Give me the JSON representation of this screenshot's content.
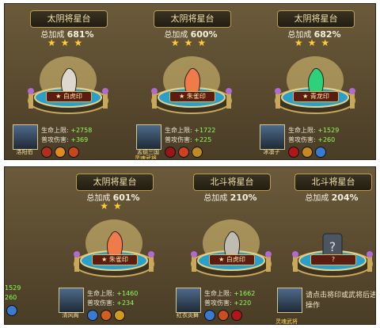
{
  "colors": {
    "panel_bg": "#5a4a30",
    "gold": "#d8b45a",
    "green_value": "#8cff5a"
  },
  "top_row": [
    {
      "title": "太阴将星台",
      "bonus_label": "总加成",
      "bonus": "681%",
      "stars": "★★★",
      "seal_text": "★ 白虎印",
      "seal_color": "#dcd8d0",
      "hp_label": "生命上限:",
      "hp": "+2758",
      "dmg_label": "普攻伤害:",
      "dmg": "+369",
      "hero": "洛阳伯",
      "badge": "",
      "skills": [
        "#b03020",
        "#e08a20",
        "#c6471a"
      ]
    },
    {
      "title": "太阴将星台",
      "bonus_label": "总加成",
      "bonus": "600%",
      "stars": "★★★",
      "seal_text": "★ 朱雀印",
      "seal_color": "#ef7a4a",
      "hp_label": "生命上限:",
      "hp": "+1722",
      "dmg_label": "普攻伤害:",
      "dmg": "+225",
      "hero": "孟德三国",
      "badge": "灵魂武将",
      "skills": [
        "#9a1515",
        "#d04020",
        "#c08a20"
      ]
    },
    {
      "title": "太阴将星台",
      "bonus_label": "总加成",
      "bonus": "682%",
      "stars": "★★★",
      "seal_text": "★ 青龙印",
      "seal_color": "#2fd07a",
      "hp_label": "生命上限:",
      "hp": "+1529",
      "dmg_label": "普攻伤害:",
      "dmg": "+260",
      "hero": "冰凛子",
      "badge": "",
      "skills": [
        "#b01818",
        "#c88a20",
        "#3a7ad0"
      ]
    }
  ],
  "bottom_row": {
    "partial": {
      "hp": "1529",
      "dmg": "260"
    },
    "cards": [
      {
        "title": "太阴将星台",
        "bonus_label": "总加成",
        "bonus": "601%",
        "stars": "★★",
        "seal_text": "★ 朱雀印",
        "seal_color": "#ef7a4a",
        "hp_label": "生命上限:",
        "hp": "+1460",
        "dmg_label": "普攻伤害:",
        "dmg": "+234",
        "hero": "清风阁",
        "badge": "",
        "skills": [
          "#3a7ad0",
          "#d06020",
          "#d09a20"
        ]
      },
      {
        "title": "北斗将星台",
        "bonus_label": "总加成",
        "bonus": "210%",
        "stars": "",
        "seal_text": "★ 白虎印",
        "seal_color": "#bfbcb2",
        "hp_label": "生命上限:",
        "hp": "+1662",
        "dmg_label": "普攻伤害:",
        "dmg": "+220",
        "hero": "红衣炎舞",
        "badge": "",
        "skills": [
          "#3a7ad0",
          "#c85020",
          "#b01818"
        ]
      },
      {
        "title": "北斗将星台",
        "bonus_label": "总加成",
        "bonus": "204%",
        "stars": "",
        "seal_text": "?",
        "seal_color": "#9aa6b0",
        "tip": "请点击将印或武将后进行操作",
        "hero": "",
        "badge": "灵魂武将",
        "skills": []
      }
    ]
  }
}
